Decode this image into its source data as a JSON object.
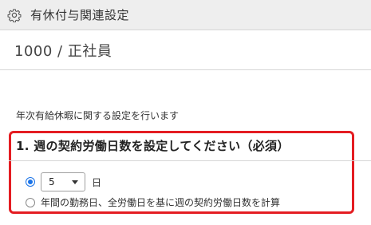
{
  "titlebar": {
    "icon": "gear-icon",
    "title": "有休付与関連設定"
  },
  "header": {
    "code": "1000 / 正社員"
  },
  "main": {
    "description": "年次有給休暇に関する設定を行います",
    "section_title": "1. 週の契約労働日数を設定してください（必須）",
    "options": [
      {
        "selected": true,
        "select_value": "5",
        "unit": "日"
      },
      {
        "selected": false,
        "label": "年間の勤務日、全労働日を基に週の契約労働日数を計算"
      }
    ]
  },
  "colors": {
    "highlight_border": "#e41d22",
    "radio_accent": "#1a73e8"
  }
}
